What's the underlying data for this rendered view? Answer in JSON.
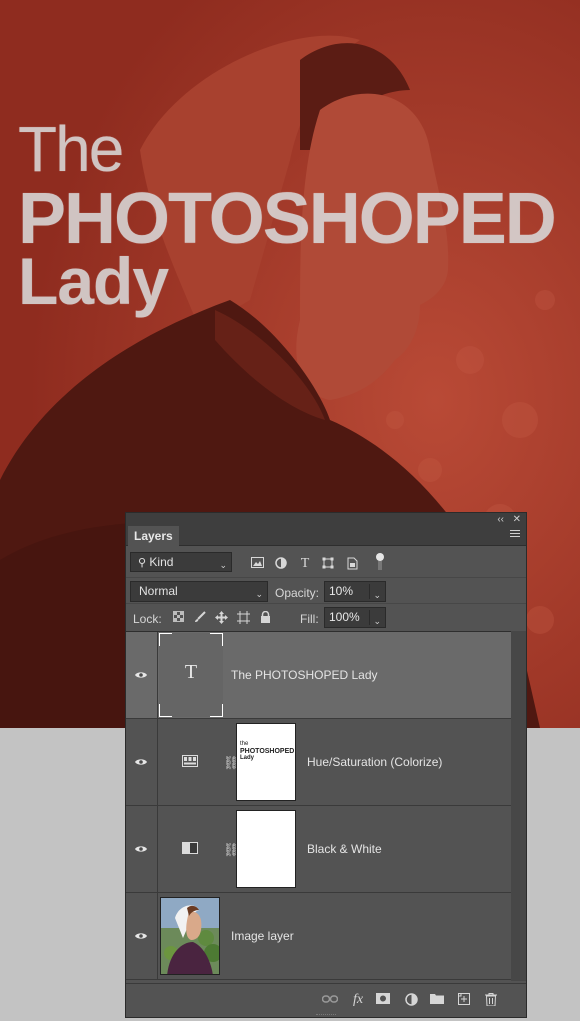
{
  "canvas": {
    "headline_line1": "The",
    "headline_line2": "PHOTOSHOPED",
    "headline_line3": "Lady",
    "tint_color": "#9a3324"
  },
  "panel": {
    "collapse_icon": "double-chevron-left-icon",
    "close_icon": "close-icon",
    "tab_label": "Layers",
    "menu_icon": "panel-menu-icon",
    "filter": {
      "kind_label": "Kind",
      "icons": [
        "pixel-layer-filter-icon",
        "adjustment-layer-filter-icon",
        "type-layer-filter-icon",
        "shape-layer-filter-icon",
        "smart-object-filter-icon"
      ]
    },
    "blend_mode": "Normal",
    "opacity_label": "Opacity:",
    "opacity_value": "10%",
    "lock_label": "Lock:",
    "fill_label": "Fill:",
    "fill_value": "100%",
    "layers": [
      {
        "name": "The PHOTOSHOPED Lady",
        "kind": "type",
        "selected": true
      },
      {
        "name": "Hue/Saturation (Colorize)",
        "kind": "adjustment",
        "mask_text_line1": "the",
        "mask_text_line2": "PHOTOSHOPED",
        "mask_text_line3": "Lady"
      },
      {
        "name": "Black & White",
        "kind": "adjustment"
      },
      {
        "name": "Image layer",
        "kind": "pixel"
      }
    ],
    "footer_icons": [
      "link-layers-icon",
      "fx-icon",
      "add-mask-icon",
      "new-adjustment-icon",
      "new-group-icon",
      "new-layer-icon",
      "delete-icon"
    ],
    "fx_label": "fx"
  }
}
